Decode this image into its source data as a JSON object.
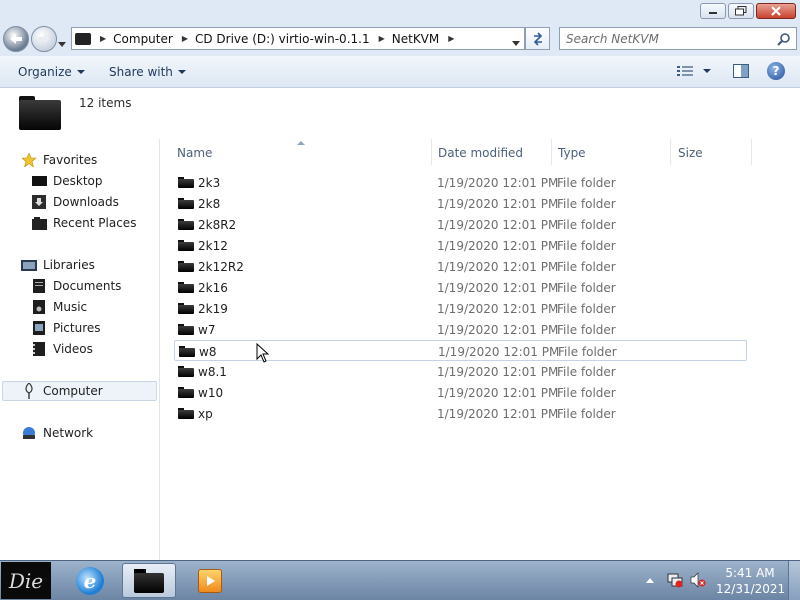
{
  "window": {
    "controls": {
      "minimize": "minimize",
      "maximize": "maximize",
      "close": "close"
    }
  },
  "address": {
    "crumbs": [
      "Computer",
      "CD Drive (D:) virtio-win-0.1.1",
      "NetKVM"
    ]
  },
  "search": {
    "placeholder": "Search NetKVM"
  },
  "toolbar": {
    "organize_label": "Organize",
    "share_label": "Share with"
  },
  "header": {
    "item_count": "12 items"
  },
  "navpane": {
    "favorites": {
      "label": "Favorites",
      "items": [
        "Desktop",
        "Downloads",
        "Recent Places"
      ]
    },
    "libraries": {
      "label": "Libraries",
      "items": [
        "Documents",
        "Music",
        "Pictures",
        "Videos"
      ]
    },
    "computer": {
      "label": "Computer"
    },
    "network": {
      "label": "Network"
    }
  },
  "columns": {
    "name": "Name",
    "date": "Date modified",
    "type": "Type",
    "size": "Size"
  },
  "files": [
    {
      "name": "2k3",
      "date": "1/19/2020 12:01 PM",
      "type": "File folder"
    },
    {
      "name": "2k8",
      "date": "1/19/2020 12:01 PM",
      "type": "File folder"
    },
    {
      "name": "2k8R2",
      "date": "1/19/2020 12:01 PM",
      "type": "File folder"
    },
    {
      "name": "2k12",
      "date": "1/19/2020 12:01 PM",
      "type": "File folder"
    },
    {
      "name": "2k12R2",
      "date": "1/19/2020 12:01 PM",
      "type": "File folder"
    },
    {
      "name": "2k16",
      "date": "1/19/2020 12:01 PM",
      "type": "File folder"
    },
    {
      "name": "2k19",
      "date": "1/19/2020 12:01 PM",
      "type": "File folder"
    },
    {
      "name": "w7",
      "date": "1/19/2020 12:01 PM",
      "type": "File folder"
    },
    {
      "name": "w8",
      "date": "1/19/2020 12:01 PM",
      "type": "File folder"
    },
    {
      "name": "w8.1",
      "date": "1/19/2020 12:01 PM",
      "type": "File folder"
    },
    {
      "name": "w10",
      "date": "1/19/2020 12:01 PM",
      "type": "File folder"
    },
    {
      "name": "xp",
      "date": "1/19/2020 12:01 PM",
      "type": "File folder"
    }
  ],
  "taskbar": {
    "start_label": "Die",
    "clock_time": "5:41 AM",
    "clock_date": "12/31/2021"
  }
}
